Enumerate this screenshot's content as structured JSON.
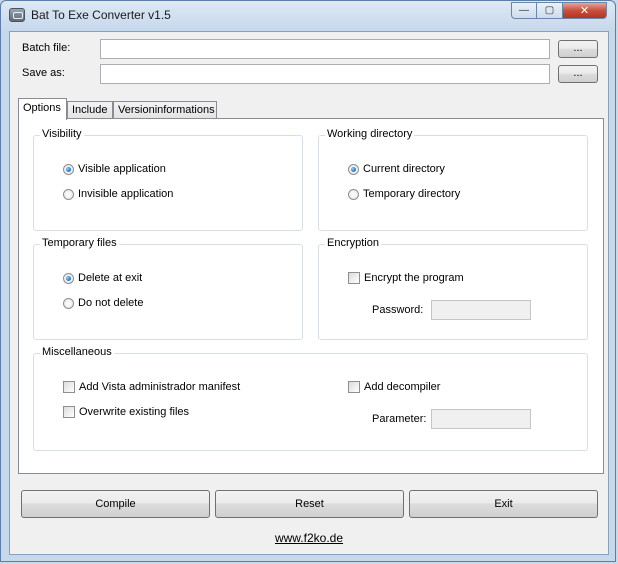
{
  "window": {
    "title": "Bat To Exe Converter v1.5",
    "controls": {
      "minimize": "—",
      "maximize": "▢",
      "close": "✕"
    }
  },
  "files": {
    "batch_label": "Batch file:",
    "batch_value": "",
    "save_label": "Save as:",
    "save_value": "",
    "browse_label": "..."
  },
  "tabs": [
    {
      "label": "Options",
      "active": true
    },
    {
      "label": "Include",
      "active": false
    },
    {
      "label": "Versioninformations",
      "active": false
    }
  ],
  "visibility": {
    "title": "Visibility",
    "options": [
      {
        "label": "Visible application",
        "selected": true
      },
      {
        "label": "Invisible application",
        "selected": false
      }
    ]
  },
  "working_directory": {
    "title": "Working directory",
    "options": [
      {
        "label": "Current directory",
        "selected": true
      },
      {
        "label": "Temporary directory",
        "selected": false
      }
    ]
  },
  "temporary_files": {
    "title": "Temporary files",
    "options": [
      {
        "label": "Delete at exit",
        "selected": true
      },
      {
        "label": "Do not delete",
        "selected": false
      }
    ]
  },
  "encryption": {
    "title": "Encryption",
    "encrypt_label": "Encrypt the program",
    "encrypt_checked": false,
    "password_label": "Password:",
    "password_value": ""
  },
  "miscellaneous": {
    "title": "Miscellaneous",
    "vista_label": "Add Vista administrador manifest",
    "overwrite_label": "Overwrite existing files",
    "decompiler_label": "Add decompiler",
    "parameter_label": "Parameter:",
    "parameter_value": ""
  },
  "actions": {
    "compile": "Compile",
    "reset": "Reset",
    "exit": "Exit"
  },
  "footer_link": "www.f2ko.de",
  "icons": {
    "app": "bat-converter-app-icon"
  }
}
